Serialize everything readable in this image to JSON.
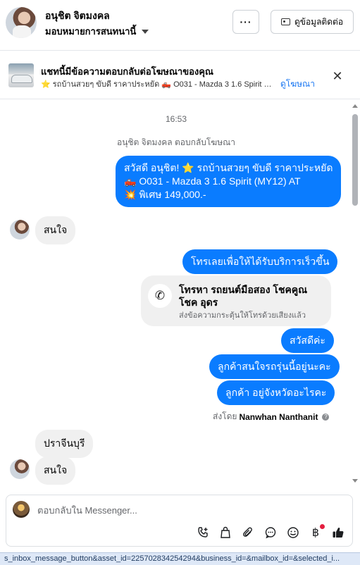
{
  "header": {
    "contact_name": "อนุชิต จิตมงคล",
    "assign_label": "มอบหมายการสนทนานี้",
    "more_label": "···",
    "contact_info_label": "ดูข้อมูลติดต่อ"
  },
  "ad_banner": {
    "title": "แชทนี้มีข้อความตอบกลับต่อโฆษณาของคุณ",
    "subtitle": "⭐ รถบ้านสวยๆ ขับดี ราคาประหยัด 🛻 O031 - Mazda 3 1.6 Spirit (MY1...",
    "view_ad_label": "ดูโฆษณา",
    "close_label": "✕"
  },
  "conversation": {
    "timestamp": "16:53",
    "system_note": "อนุชิต จิตมงคล ตอบกลับโฆษณา",
    "ad_message": {
      "line1": "สวัสดี อนุชิต! ⭐ รถบ้านสวยๆ ขับดี ราคาประหยัด",
      "line2": "🛻 O031 - Mazda 3 1.6 Spirit (MY12) AT",
      "line3": "💥 พิเศษ 149,000.-"
    },
    "incoming_1": "สนใจ",
    "outgoing_call_prompt": "โทรเลยเพื่อให้ได้รับบริการเร็วขึ้น",
    "call_card": {
      "title": "โทรหา รถยนต์มือสอง โชคคูณ โชค อุดร",
      "subtitle": "ส่งข้อความกระตุ้นให้โทรด้วยเสียงแล้ว"
    },
    "outgoing_greeting": "สวัสดีค่ะ",
    "outgoing_question_1": "ลูกค้าสนใจรถรุ่นนี้อยู่นะคะ",
    "outgoing_question_2": "ลูกค้า อยู่จังหวัดอะไรคะ",
    "sent_by_prefix": "ส่งโดย",
    "sent_by_name": "Nanwhan Nanthanit",
    "incoming_2": "ปราจีนบุรี",
    "incoming_3": "สนใจ"
  },
  "composer": {
    "placeholder": "ตอบกลับใน Messenger..."
  },
  "status_bar": {
    "url": "s_inbox_message_button&asset_id=225702834254294&business_id=&mailbox_id=&selected_i..."
  },
  "colors": {
    "outgoing_bubble": "#0a7cff",
    "incoming_bubble": "#f0f0f0",
    "link": "#1876f2",
    "notification_dot": "#e41e3f"
  },
  "icons": [
    "chevron-down-icon",
    "more-icon",
    "contact-card-icon",
    "close-icon",
    "phone-icon",
    "info-icon",
    "add-call-icon",
    "bag-icon",
    "attach-icon",
    "chat-icon",
    "emoji-icon",
    "baht-icon",
    "thumbs-up-icon"
  ]
}
